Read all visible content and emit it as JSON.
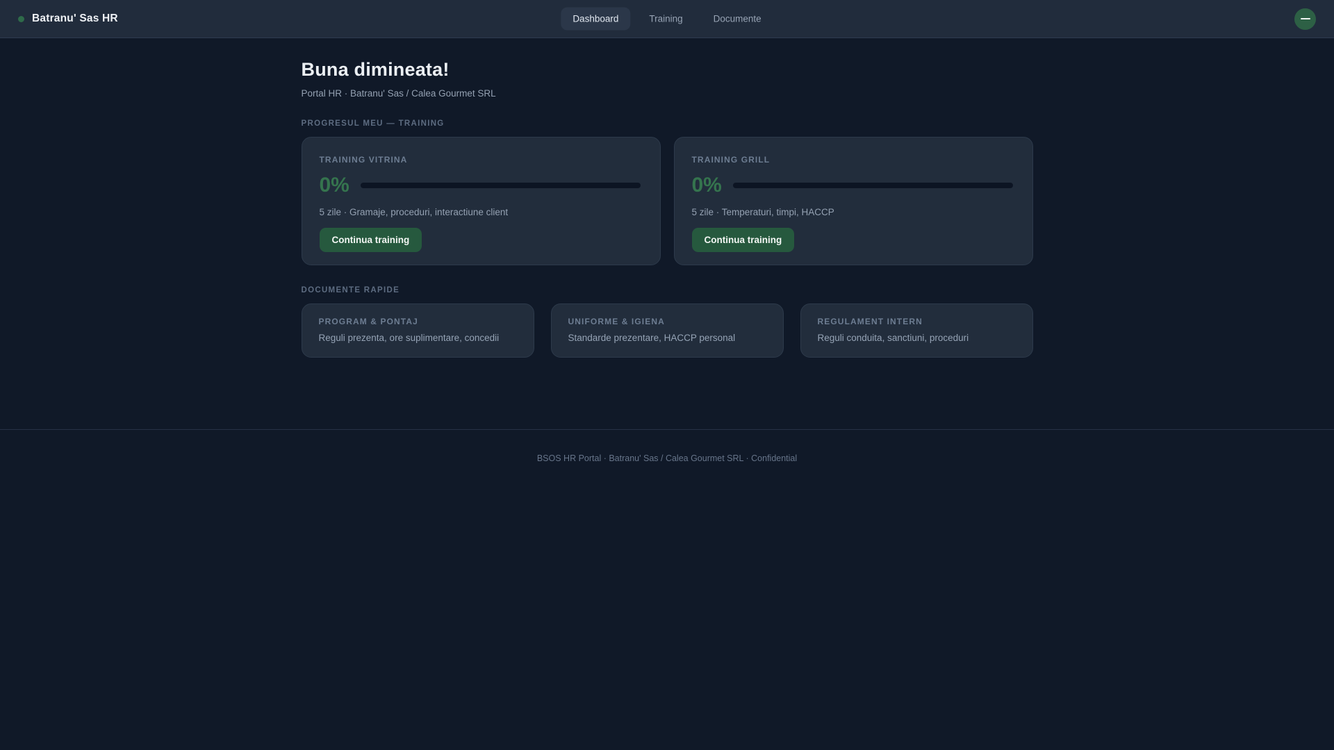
{
  "header": {
    "brand": "Batranu' Sas HR",
    "nav": [
      {
        "label": "Dashboard",
        "active": true
      },
      {
        "label": "Training",
        "active": false
      },
      {
        "label": "Documente",
        "active": false
      }
    ],
    "minimize_icon": "minus",
    "accent_green": "#2d6045"
  },
  "main": {
    "greeting": "Buna dimineata!",
    "subtitle": "Portal HR · Batranu' Sas / Calea Gourmet SRL",
    "training_section": {
      "label": "PROGRESUL MEU — TRAINING",
      "cards": [
        {
          "title": "TRAINING VITRINA",
          "percent": "0%",
          "progress_value": 0,
          "description": "5 zile · Gramaje, proceduri, interactiune client",
          "button": "Continua training"
        },
        {
          "title": "TRAINING GRILL",
          "percent": "0%",
          "progress_value": 0,
          "description": "5 zile · Temperaturi, timpi, HACCP",
          "button": "Continua training"
        }
      ]
    },
    "documents_section": {
      "label": "DOCUMENTE RAPIDE",
      "cards": [
        {
          "title": "PROGRAM & PONTAJ",
          "description": "Reguli prezenta, ore suplimentare, concedii"
        },
        {
          "title": "UNIFORME & IGIENA",
          "description": "Standarde prezentare, HACCP personal"
        },
        {
          "title": "REGULAMENT INTERN",
          "description": "Reguli conduita, sanctiuni, proceduri"
        }
      ]
    }
  },
  "footer": {
    "text": "BSOS HR Portal · Batranu' Sas / Calea Gourmet SRL · Confidential"
  },
  "colors": {
    "header_bg": "#212c3c",
    "page_bg": "#101928",
    "card_bg": "#222d3c",
    "accent_green": "#35744e",
    "button_green": "#26593e"
  }
}
